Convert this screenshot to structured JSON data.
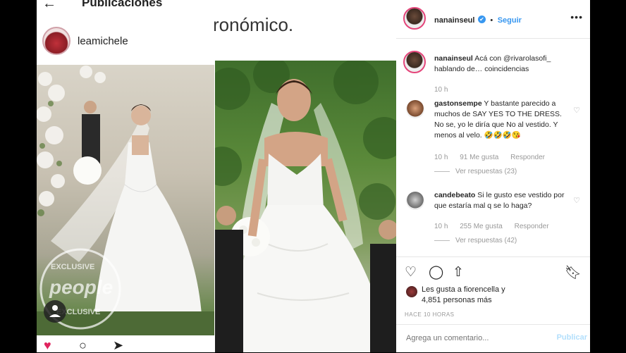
{
  "left": {
    "header_title": "Publicaciones",
    "caption_fragment": "ronómico.",
    "post_username": "leamichele",
    "watermark_top": "EXCLUSIVE",
    "watermark_brand": "people",
    "watermark_bottom": "EXCLUSIVE"
  },
  "instagram": {
    "header": {
      "username": "nanainseul",
      "verified": "✔",
      "separator": "•",
      "follow": "Seguir",
      "more": "•••"
    },
    "caption": {
      "username": "nanainseul",
      "text": "Acá con @rivarolasofi_ hablando de… coincidencias",
      "time": "10 h"
    },
    "comments": [
      {
        "username": "gastonsempe",
        "text": "Y bastante parecido a muchos de SAY YES TO THE DRESS. No se, yo le diría que No al vestido. Y menos al velo. 🤣🤣🤣😘",
        "time": "10 h",
        "likes": "91 Me gusta",
        "reply": "Responder",
        "view_replies": "Ver respuestas (23)"
      },
      {
        "username": "candebeato",
        "text": "Si le gusto ese vestido por que estaría mal q se lo haga?",
        "time": "10 h",
        "likes": "255 Me gusta",
        "reply": "Responder",
        "view_replies": "Ver respuestas (42)"
      }
    ],
    "likes_text_1": "Les gusta a fiorencella y",
    "likes_text_2": "4,851 personas más",
    "time_ago": "HACE 10 HORAS",
    "comment_placeholder": "Agrega un comentario...",
    "post_button": "Publicar"
  },
  "colors": {
    "accent": "#3897f0",
    "text": "#262626",
    "muted": "#999999"
  }
}
